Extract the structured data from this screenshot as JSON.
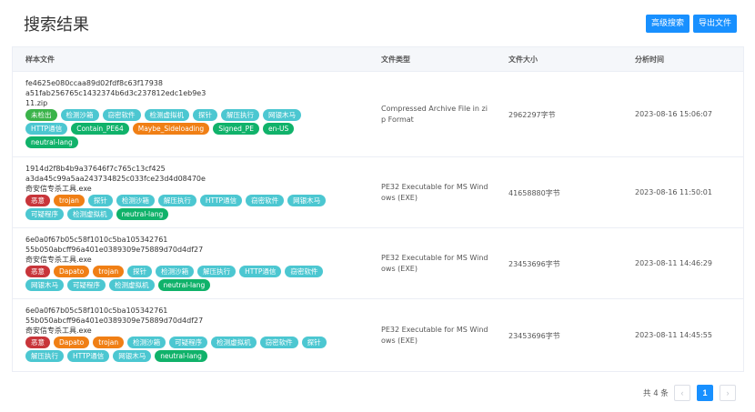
{
  "header": {
    "title": "搜索结果",
    "advanced_search_label": "高级搜索",
    "export_label": "导出文件",
    "accent_color": "#1890ff"
  },
  "table": {
    "columns": [
      "样本文件",
      "文件类型",
      "文件大小",
      "分析时间"
    ],
    "rows": [
      {
        "lines": [
          "fe4625e080ccaa89d02fdf8c63f17938",
          "a51fab256765c1432374b6d3c237812edc1eb9e3",
          "11.zip"
        ],
        "tags": [
          {
            "text": "未检出",
            "color": "#3ab34a"
          },
          {
            "text": "检测沙箱",
            "color": "#4cc7d1"
          },
          {
            "text": "窃密软件",
            "color": "#4cc7d1"
          },
          {
            "text": "检测虚拟机",
            "color": "#4cc7d1"
          },
          {
            "text": "探针",
            "color": "#4cc7d1"
          },
          {
            "text": "解压执行",
            "color": "#4cc7d1"
          },
          {
            "text": "网银木马",
            "color": "#4cc7d1"
          },
          {
            "text": "HTTP通信",
            "color": "#4cc7d1"
          },
          {
            "text": "Contain_PE64",
            "color": "#10b26a"
          },
          {
            "text": "Maybe_Sideloading",
            "color": "#f07f15"
          },
          {
            "text": "Signed_PE",
            "color": "#10b26a"
          },
          {
            "text": "en-US",
            "color": "#10b26a"
          },
          {
            "text": "neutral-lang",
            "color": "#10b26a"
          }
        ],
        "type": "Compressed Archive File in zip Format",
        "size": "2962297字节",
        "time": "2023-08-16 15:06:07"
      },
      {
        "lines": [
          "1914d2f8b4b9a37646f7c765c13cf425",
          "a3da45c99a5aa243734825c033fce23d4d08470e",
          "奇安信专杀工具.exe"
        ],
        "tags": [
          {
            "text": "恶意",
            "color": "#c8353a"
          },
          {
            "text": "trojan",
            "color": "#f07f15"
          },
          {
            "text": "探针",
            "color": "#4cc7d1"
          },
          {
            "text": "检测沙箱",
            "color": "#4cc7d1"
          },
          {
            "text": "解压执行",
            "color": "#4cc7d1"
          },
          {
            "text": "HTTP通信",
            "color": "#4cc7d1"
          },
          {
            "text": "窃密软件",
            "color": "#4cc7d1"
          },
          {
            "text": "网银木马",
            "color": "#4cc7d1"
          },
          {
            "text": "可疑程序",
            "color": "#4cc7d1"
          },
          {
            "text": "检测虚拟机",
            "color": "#4cc7d1"
          },
          {
            "text": "neutral-lang",
            "color": "#10b26a"
          }
        ],
        "type": "PE32 Executable for MS Windows (EXE)",
        "size": "41658880字节",
        "time": "2023-08-16 11:50:01"
      },
      {
        "lines": [
          "6e0a0f67b05c58f1010c5ba105342761",
          "55b050abcff96a401e0389309e75889d70d4df27",
          "奇安信专杀工具.exe"
        ],
        "tags": [
          {
            "text": "恶意",
            "color": "#c8353a"
          },
          {
            "text": "Dapato",
            "color": "#f07f15"
          },
          {
            "text": "trojan",
            "color": "#f07f15"
          },
          {
            "text": "探针",
            "color": "#4cc7d1"
          },
          {
            "text": "检测沙箱",
            "color": "#4cc7d1"
          },
          {
            "text": "解压执行",
            "color": "#4cc7d1"
          },
          {
            "text": "HTTP通信",
            "color": "#4cc7d1"
          },
          {
            "text": "窃密软件",
            "color": "#4cc7d1"
          },
          {
            "text": "网银木马",
            "color": "#4cc7d1"
          },
          {
            "text": "可疑程序",
            "color": "#4cc7d1"
          },
          {
            "text": "检测虚拟机",
            "color": "#4cc7d1"
          },
          {
            "text": "neutral-lang",
            "color": "#10b26a"
          }
        ],
        "type": "PE32 Executable for MS Windows (EXE)",
        "size": "23453696字节",
        "time": "2023-08-11 14:46:29"
      },
      {
        "lines": [
          "6e0a0f67b05c58f1010c5ba105342761",
          "55b050abcff96a401e0389309e75889d70d4df27",
          "奇安信专杀工具.exe"
        ],
        "tags": [
          {
            "text": "恶意",
            "color": "#c8353a"
          },
          {
            "text": "Dapato",
            "color": "#f07f15"
          },
          {
            "text": "trojan",
            "color": "#f07f15"
          },
          {
            "text": "检测沙箱",
            "color": "#4cc7d1"
          },
          {
            "text": "可疑程序",
            "color": "#4cc7d1"
          },
          {
            "text": "检测虚拟机",
            "color": "#4cc7d1"
          },
          {
            "text": "窃密软件",
            "color": "#4cc7d1"
          },
          {
            "text": "探针",
            "color": "#4cc7d1"
          },
          {
            "text": "解压执行",
            "color": "#4cc7d1"
          },
          {
            "text": "HTTP通信",
            "color": "#4cc7d1"
          },
          {
            "text": "网银木马",
            "color": "#4cc7d1"
          },
          {
            "text": "neutral-lang",
            "color": "#10b26a"
          }
        ],
        "type": "PE32 Executable for MS Windows (EXE)",
        "size": "23453696字节",
        "time": "2023-08-11 14:45:55"
      }
    ]
  },
  "pagination": {
    "total_label": "共 4 条",
    "prev_icon": "‹",
    "current_page": "1",
    "next_icon": "›"
  }
}
